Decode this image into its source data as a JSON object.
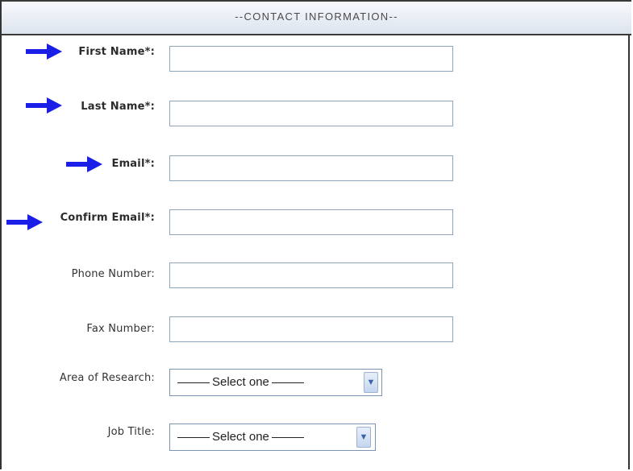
{
  "header": {
    "title": "--CONTACT INFORMATION--"
  },
  "form": {
    "fields": [
      {
        "label": "First Name*:",
        "value": ""
      },
      {
        "label": "Last Name*:",
        "value": ""
      },
      {
        "label": "Email*:",
        "value": ""
      },
      {
        "label": "Confirm Email*:",
        "value": ""
      },
      {
        "label": "Phone Number:",
        "value": ""
      },
      {
        "label": "Fax Number:",
        "value": ""
      }
    ],
    "area_of_research": {
      "label": "Area of Research:",
      "selected": "Select one"
    },
    "job_title": {
      "label": "Job Title:",
      "selected": "Select one"
    }
  },
  "colors": {
    "arrow": "#1a1ee6",
    "header_border": "#3a3a3a",
    "field_border": "#8fa4bd"
  },
  "icons": {
    "required_marker": "arrow-right-icon",
    "dropdown": "chevron-down-icon"
  }
}
